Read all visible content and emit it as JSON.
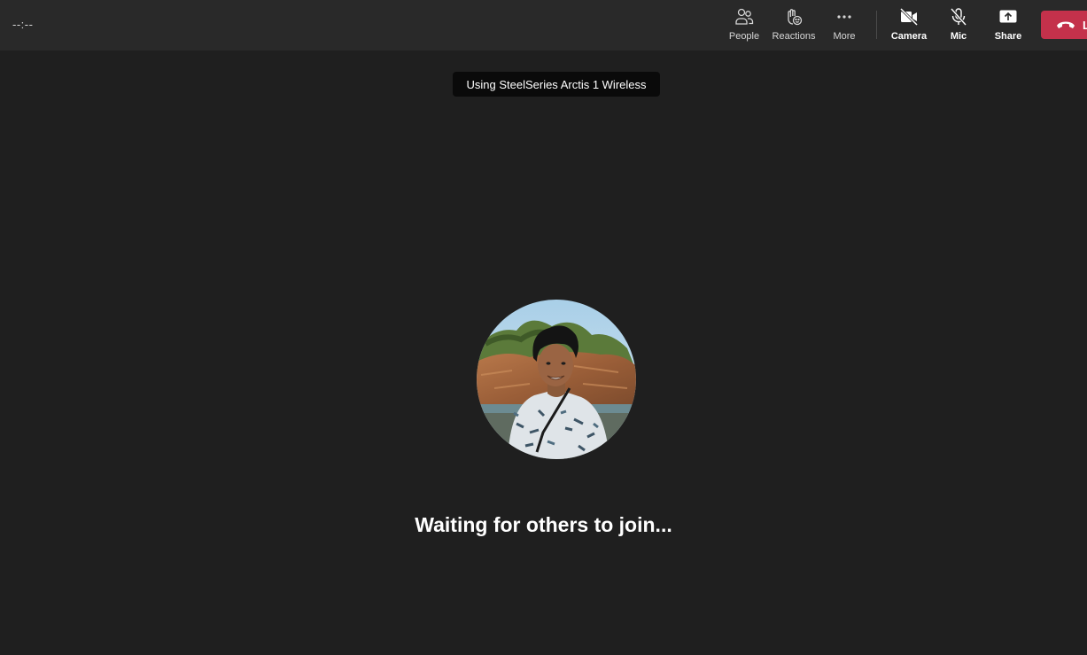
{
  "call": {
    "timer": "--:--"
  },
  "toolbar": {
    "people_label": "People",
    "reactions_label": "Reactions",
    "more_label": "More",
    "camera_label": "Camera",
    "mic_label": "Mic",
    "share_label": "Share",
    "leave_label": "L"
  },
  "toast": {
    "device": "Using SteelSeries Arctis 1 Wireless"
  },
  "stage": {
    "status": "Waiting for others to join..."
  },
  "colors": {
    "background": "#1f1f1f",
    "topbar": "#292929",
    "leave": "#c4314b"
  },
  "icons": [
    "people-icon",
    "reactions-icon",
    "more-icon",
    "camera-off-icon",
    "mic-off-icon",
    "share-icon",
    "hang-up-icon"
  ]
}
